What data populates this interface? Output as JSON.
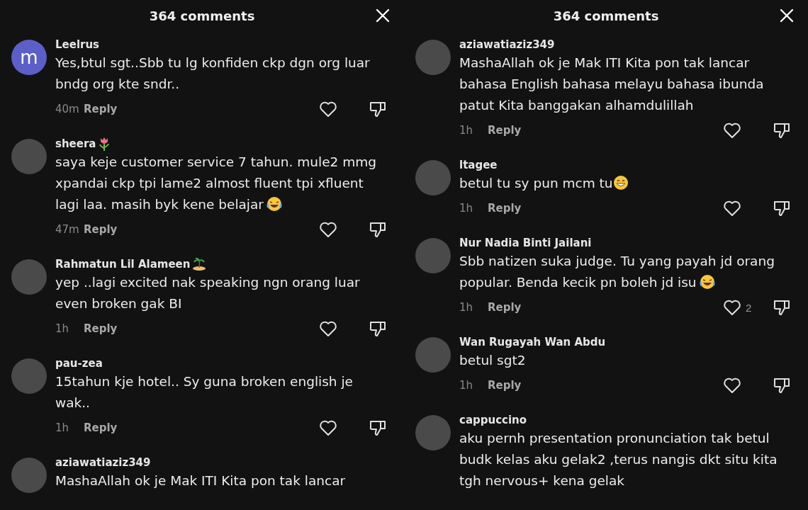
{
  "panels": [
    {
      "title": "364 comments",
      "comments": [
        {
          "avatar": {
            "kind": "letter",
            "letter": "m",
            "color": "#5b5fc7"
          },
          "name": "Leelrus",
          "text": "Yes,btul sgt..Sbb tu lg konfiden ckp dgn org luar bndg org kte sndr..",
          "time": "40m",
          "reply": "Reply"
        },
        {
          "avatar": {
            "kind": "photo"
          },
          "name": "sheera",
          "name_emoji": {
            "kind": "flower"
          },
          "text": "saya keje customer service 7 tahun. mule2 mmg xpandai ckp tpi lame2 almost fluent tpi xfluent lagi laa. masih byk kene belajar",
          "text_emoji": {
            "kind": "laugh"
          },
          "time": "47m",
          "reply": "Reply"
        },
        {
          "avatar": {
            "kind": "photo"
          },
          "name": "Rahmatun Lil Alameen",
          "name_emoji": {
            "kind": "island"
          },
          "text": "yep ..lagi excited nak speaking ngn orang luar even broken gak BI",
          "time": "1h",
          "reply": "Reply"
        },
        {
          "avatar": {
            "kind": "photo"
          },
          "name": "pau-zea",
          "text": "15tahun kje hotel.. Sy guna broken english je wak..",
          "time": "1h",
          "reply": "Reply"
        },
        {
          "avatar": {
            "kind": "photo"
          },
          "name": "aziawatiaziz349",
          "text": "MashaAllah ok je Mak ITI Kita pon tak lancar"
        }
      ]
    },
    {
      "title": "364 comments",
      "comments": [
        {
          "avatar": {
            "kind": "photo"
          },
          "name": "aziawatiaziz349",
          "text": "MashaAllah ok je Mak ITI Kita pon tak lancar bahasa English bahasa melayu bahasa ibunda patut Kita banggakan alhamdulillah",
          "time": "1h",
          "reply": "Reply"
        },
        {
          "avatar": {
            "kind": "photo"
          },
          "name": "ltagee",
          "text": "betul tu sy pun mcm tu",
          "text_emoji": {
            "kind": "grin"
          },
          "time": "1h",
          "reply": "Reply"
        },
        {
          "avatar": {
            "kind": "photo"
          },
          "name": "Nur Nadia Binti Jailani",
          "text": "Sbb natizen suka judge. Tu yang payah jd orang popular. Benda kecik pn boleh jd isu",
          "text_emoji": {
            "kind": "laugh"
          },
          "time": "1h",
          "reply": "Reply",
          "likes": "2"
        },
        {
          "avatar": {
            "kind": "photo"
          },
          "name": "Wan Rugayah Wan Abdu",
          "text": "betul sgt2",
          "time": "1h",
          "reply": "Reply"
        },
        {
          "avatar": {
            "kind": "photo"
          },
          "name": "cappuccino",
          "text": "aku pernh presentation pronunciation tak betul budk kelas aku gelak2 ,terus nangis dkt situ kita tgh nervous+ kena gelak"
        }
      ]
    }
  ]
}
